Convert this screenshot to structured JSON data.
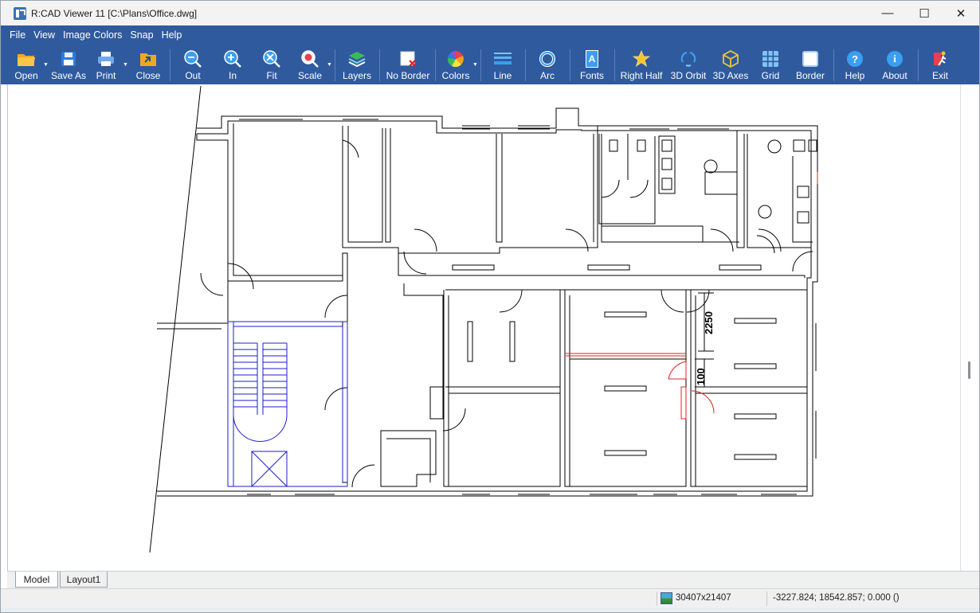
{
  "window": {
    "title": "R:CAD Viewer 11 [C:\\Plans\\Office.dwg]",
    "controls": {
      "minimize": "—",
      "maximize": "☐",
      "close": "✕"
    }
  },
  "menu": {
    "items": [
      "File",
      "View",
      "Image Colors",
      "Snap",
      "Help"
    ]
  },
  "toolbar": {
    "buttons": [
      {
        "label": "Open",
        "icon": "folder-open-icon"
      },
      {
        "label": "Save As",
        "icon": "floppy-disk-icon"
      },
      {
        "label": "Print",
        "icon": "printer-icon"
      },
      {
        "label": "Close",
        "icon": "folder-close-icon"
      },
      {
        "label": "Out",
        "icon": "zoom-out-icon"
      },
      {
        "label": "In",
        "icon": "zoom-in-icon"
      },
      {
        "label": "Fit",
        "icon": "zoom-fit-icon"
      },
      {
        "label": "Scale",
        "icon": "zoom-scale-icon"
      },
      {
        "label": "Layers",
        "icon": "layers-icon"
      },
      {
        "label": "No Border",
        "icon": "no-border-icon"
      },
      {
        "label": "Colors",
        "icon": "color-wheel-icon"
      },
      {
        "label": "Line",
        "icon": "line-weight-icon"
      },
      {
        "label": "Arc",
        "icon": "arc-circle-icon"
      },
      {
        "label": "Fonts",
        "icon": "font-icon"
      },
      {
        "label": "Right Half",
        "icon": "star-icon"
      },
      {
        "label": "3D Orbit",
        "icon": "orbit-icon"
      },
      {
        "label": "3D Axes",
        "icon": "cube-icon"
      },
      {
        "label": "Grid",
        "icon": "grid-icon"
      },
      {
        "label": "Border",
        "icon": "border-square-icon"
      },
      {
        "label": "Help",
        "icon": "help-icon"
      },
      {
        "label": "About",
        "icon": "info-icon"
      },
      {
        "label": "Exit",
        "icon": "exit-runner-icon"
      }
    ],
    "icon_text": {
      "fonts": "A",
      "help": "?",
      "about": "i"
    }
  },
  "drawing": {
    "dimensions": [
      "2250",
      "100"
    ]
  },
  "tabs": [
    "Model",
    "Layout1"
  ],
  "status": {
    "image_size": "30407x21407",
    "coordinates": "-3227.824; 18542.857; 0.000 ()"
  },
  "colors": {
    "toolbar_bg": "#2f5a9e",
    "drawing_lines": "#000000",
    "stairs_blue": "#1c1ccf",
    "highlight_red": "#e02020"
  }
}
